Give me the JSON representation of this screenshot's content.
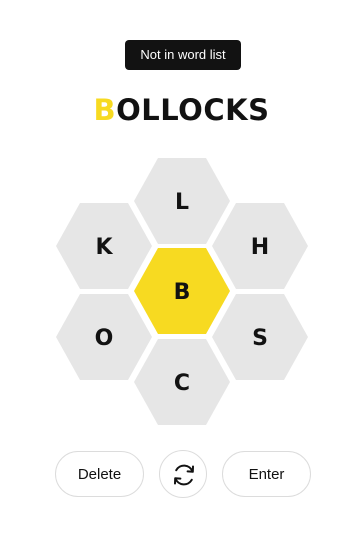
{
  "toast": {
    "message": "Not in word list"
  },
  "input_word": {
    "first_letter": "B",
    "rest": "OLLOCKS"
  },
  "hive": {
    "center": "B",
    "top": "L",
    "upper_left": "K",
    "upper_right": "H",
    "lower_left": "O",
    "lower_right": "S",
    "bottom": "C"
  },
  "controls": {
    "delete_label": "Delete",
    "enter_label": "Enter",
    "shuffle_icon": "shuffle-icon"
  },
  "colors": {
    "center_cell": "#f7da21",
    "outer_cell": "#e6e6e6",
    "toast_bg": "#121212"
  }
}
